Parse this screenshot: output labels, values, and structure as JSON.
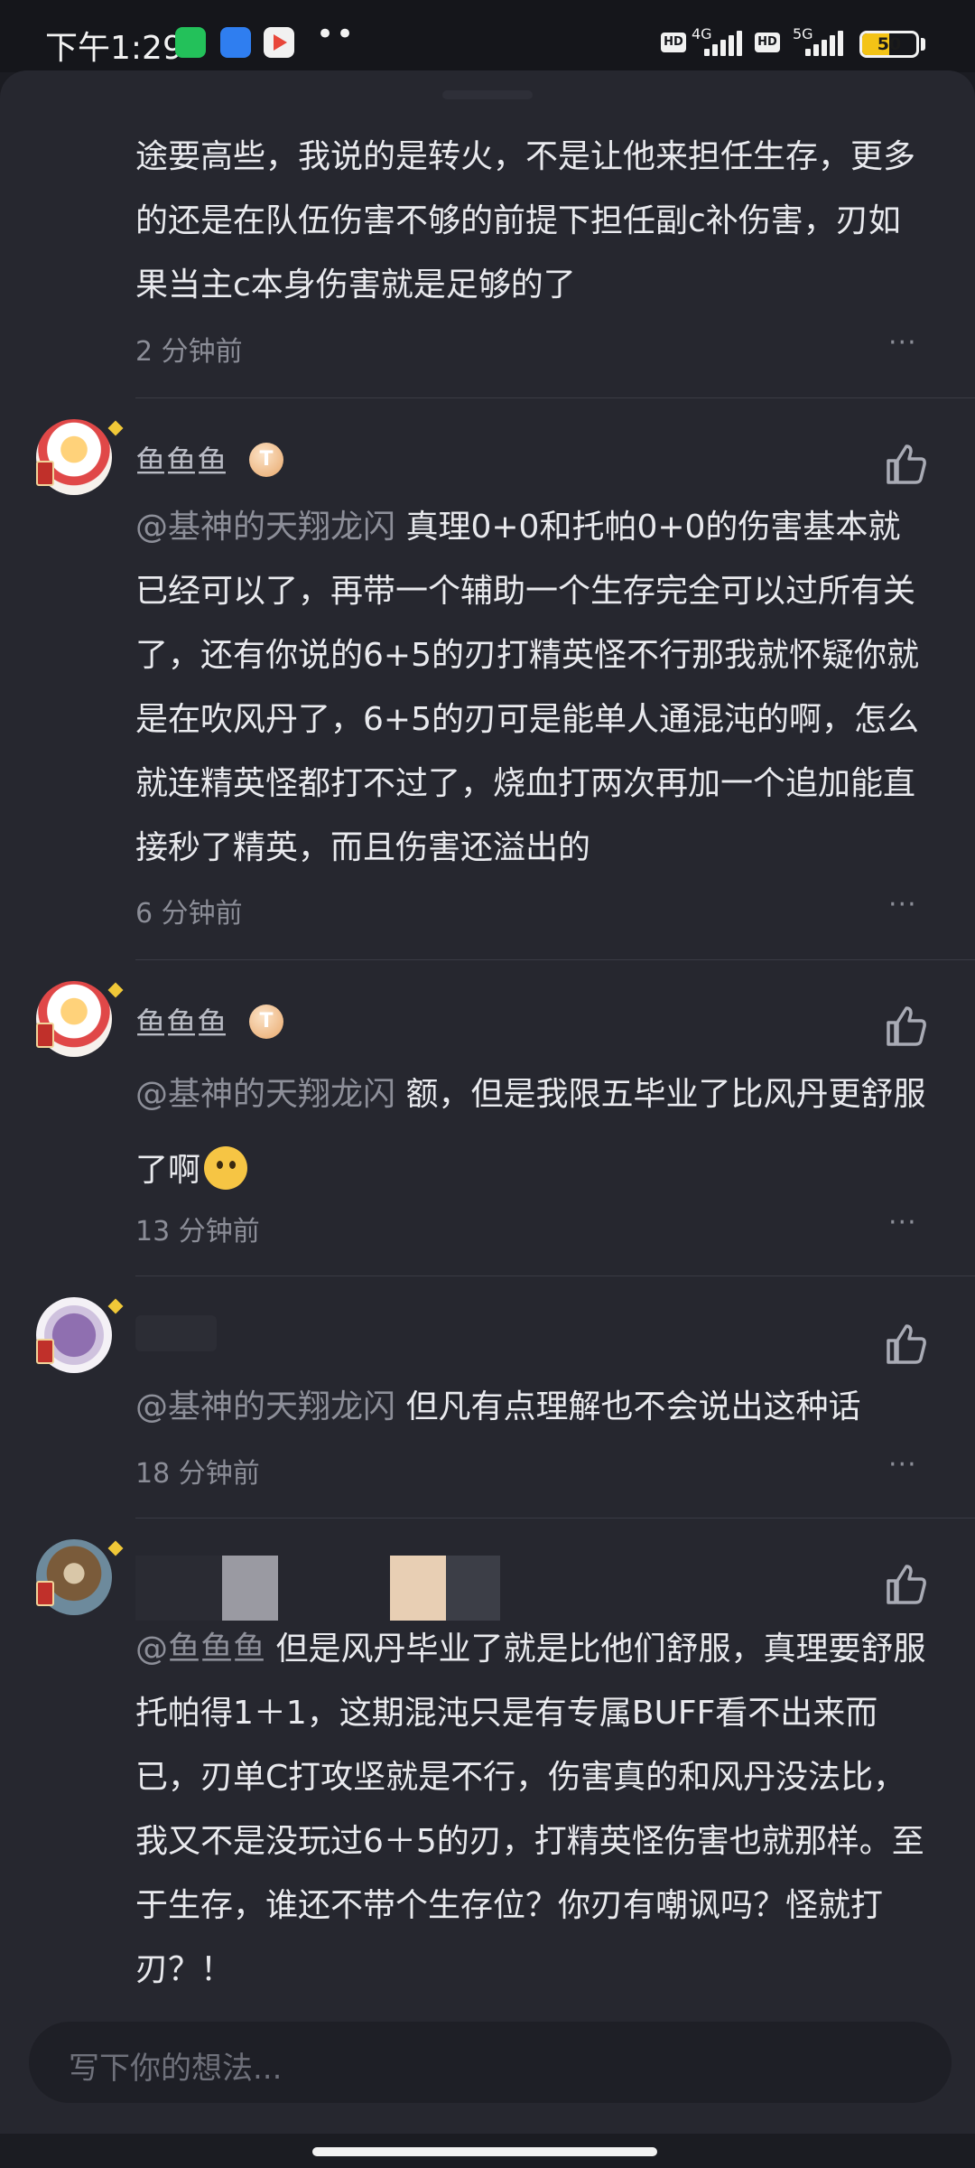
{
  "status_bar": {
    "time": "下午1:29",
    "network_1": "4G",
    "network_2": "5G",
    "hd_1": "HD",
    "hd_2": "HD",
    "battery_level": "50",
    "icons": [
      "wechat-icon",
      "radio-icon",
      "play-icon",
      "more-dots-icon",
      "signal-icon",
      "battery-icon"
    ]
  },
  "comments": [
    {
      "text": "途要高些，我说的是转火，不是让他来担任生存，更多的还是在队伍伤害不够的前提下担任副c补伤害，刃如果当主c本身伤害就是足够的了",
      "time": "2 分钟前",
      "more": "···"
    },
    {
      "username": "鱼鱼鱼",
      "level_badge": "T",
      "mention": "@基神的天翔龙闪",
      "text": "真理0+0和托帕0+0的伤害基本就已经可以了，再带一个辅助一个生存完全可以过所有关了，还有你说的6+5的刃打精英怪不行那我就怀疑你就是在吹风丹了，6+5的刃可是能单人通混沌的啊，怎么就连精英怪都打不过了，烧血打两次再加一个追加能直接秒了精英，而且伤害还溢出的",
      "time": "6 分钟前",
      "more": "···"
    },
    {
      "username": "鱼鱼鱼",
      "level_badge": "T",
      "mention": "@基神的天翔龙闪",
      "text": "额，但是我限五毕业了比风丹更舒服了啊",
      "time": "13 分钟前",
      "more": "···"
    },
    {
      "mention": "@基神的天翔龙闪",
      "text": "但凡有点理解也不会说出这种话",
      "time": "18 分钟前",
      "more": "···"
    },
    {
      "mention": "@鱼鱼鱼",
      "text": "但是风丹毕业了就是比他们舒服，真理要舒服托帕得1＋1，这期混沌只是有专属BUFF看不出来而已，刃单C打攻坚就是不行，伤害真的和风丹没法比，我又不是没玩过6＋5的刃，打精英怪伤害也就那样。至于生存，谁还不带个生存位？你刃有嘲讽吗？怪就打刃？！"
    }
  ],
  "input": {
    "placeholder": "写下你的想法..."
  },
  "colors": {
    "background": "#26272f",
    "status_bar": "#15161b",
    "text": "#e9eaee",
    "muted": "#8b8d97",
    "battery": "#f3c316"
  }
}
